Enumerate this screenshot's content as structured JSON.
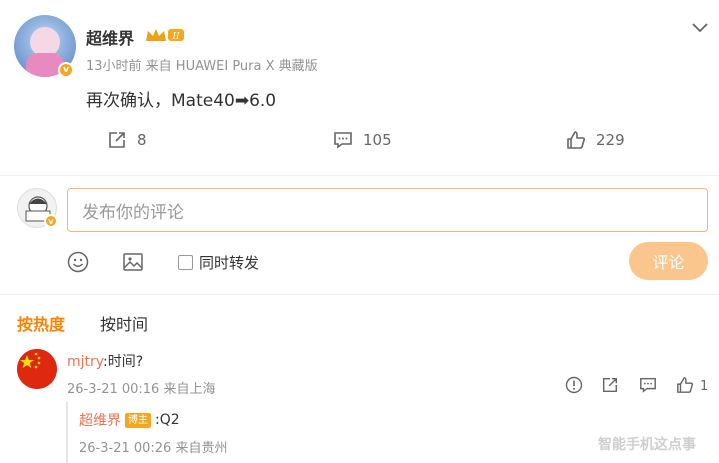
{
  "post": {
    "author": "超维界",
    "meta": "13小时前 来自 HUAWEI Pura X 典藏版",
    "text": "再次确认，Mate40➡6.0",
    "verified_badge": "v",
    "level_badge": "II"
  },
  "actions": {
    "share_count": "8",
    "comment_count": "105",
    "like_count": "229"
  },
  "composer": {
    "placeholder": "发布你的评论",
    "repost_label": "同时转发",
    "submit_label": "评论"
  },
  "sort": {
    "hot_label": "按热度",
    "time_label": "按时间"
  },
  "comments": [
    {
      "author": "mjtry",
      "text": ":时间?",
      "meta": "26-3-21 00:16 来自上海",
      "like_count": "1",
      "reply": {
        "author": "超维界",
        "badge": "博主",
        "text": ":Q2",
        "meta": "26-3-21 00:26 来自贵州"
      }
    }
  ],
  "watermark": "智能手机这点事",
  "colors": {
    "accent": "#ff8200",
    "name_link": "#eb7350",
    "input_border": "#f7b77a",
    "submit_disabled": "#fbc58e",
    "badge": "#f5a623"
  },
  "icons": [
    "chevron-down-icon",
    "share-icon",
    "comment-icon",
    "like-icon",
    "emoji-icon",
    "image-icon",
    "report-icon"
  ]
}
